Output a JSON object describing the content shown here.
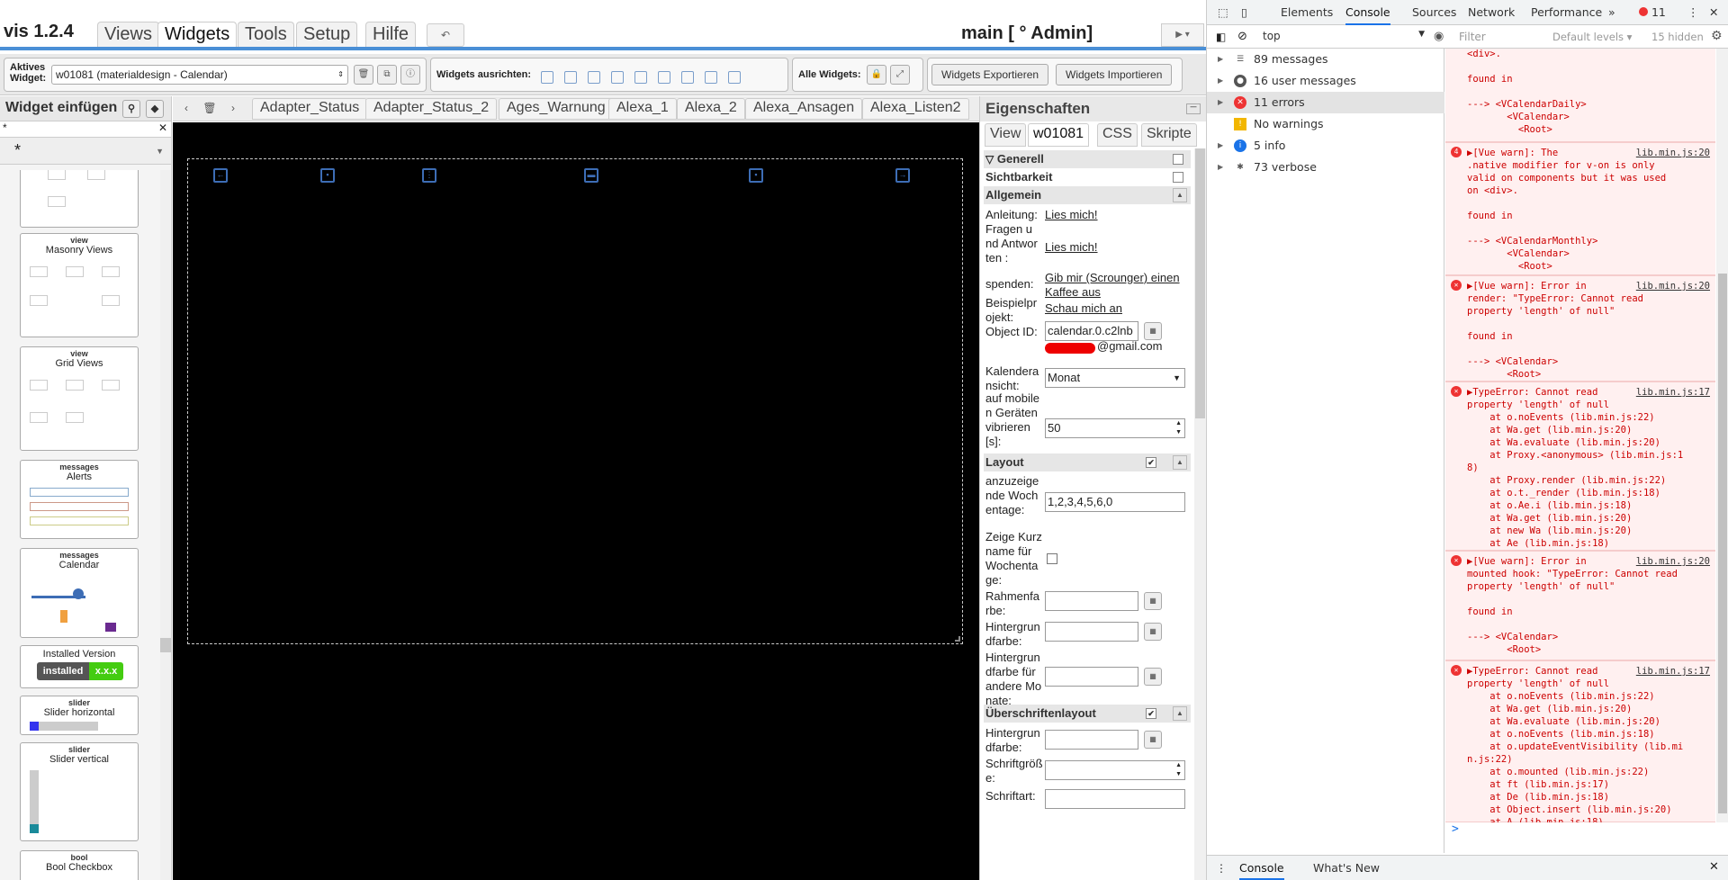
{
  "app": {
    "version": "vis 1.2.4",
    "menu_tabs": [
      "Views",
      "Widgets",
      "Tools",
      "Setup",
      "Hilfe"
    ],
    "project": "main [ ° Admin]"
  },
  "toolbar": {
    "active_label": "Aktives Widget:",
    "active_widget": "w01081 (materialdesign - Calendar)",
    "align_label": "Widgets ausrichten:",
    "all_label": "Alle Widgets:",
    "export_button": "Widgets Exportieren",
    "import_button": "Widgets Importieren"
  },
  "left_panel": {
    "title": "Widget einfügen",
    "filter_value": "*",
    "category": "*",
    "widgets": [
      {
        "type": "view",
        "name": "Masonry Views"
      },
      {
        "type": "view",
        "name": "Grid Views"
      },
      {
        "type": "messages",
        "name": "Alerts"
      },
      {
        "type": "messages",
        "name": "Calendar"
      },
      {
        "type": "",
        "name": "Installed Version"
      },
      {
        "type": "slider",
        "name": "Slider horizontal"
      },
      {
        "type": "slider",
        "name": "Slider vertical"
      },
      {
        "type": "bool",
        "name": "Bool Checkbox"
      }
    ],
    "installed_badge": "installed",
    "installed_version": "x.x.x"
  },
  "view_tabs": [
    "Adapter_Status",
    "Adapter_Status_2",
    "Ages_Warnung",
    "Alexa_1",
    "Alexa_2",
    "Alexa_Ansagen",
    "Alexa_Listen2"
  ],
  "properties": {
    "title": "Eigenschaften",
    "tabs": [
      "View",
      "w01081",
      "CSS",
      "Skripte"
    ],
    "sections": {
      "generell": "Generell",
      "sichtbarkeit": "Sichtbarkeit",
      "allgemein": "Allgemein",
      "layout": "Layout",
      "ueberschriften": "Überschriftenlayout"
    },
    "anleitung_label": "Anleitung:",
    "anleitung_link": "Lies mich!",
    "faq_label": "Fragen und Antworten :",
    "faq_link": "Lies mich!",
    "spenden_label": "spenden:",
    "spenden_link": "Gib mir (Scrounger) einen Kaffee aus",
    "beispiel_label": "Beispielprojekt:",
    "beispiel_link": "Schau mich an",
    "object_id_label": "Object ID:",
    "object_id_value": "calendar.0.c2lnb",
    "object_email": "@gmail.com",
    "ansicht_label": "Kalenderansicht:",
    "ansicht_value": "Monat",
    "vibrate_label": "auf mobilen Geräten vibrieren [s]:",
    "vibrate_value": "50",
    "wochentage_label": "anzuzeigende Wochentage:",
    "wochentage_value": "1,2,3,4,5,6,0",
    "kurzname_label": "Zeige Kurzname für Wochentage:",
    "rahmen_label": "Rahmenfarbe:",
    "hintergrund_label": "Hintergrundfarbe:",
    "hintergrund_andere_label": "Hintergrundfarbe für andere Monate:",
    "ueber_hintergrund_label": "Hintergrundfarbe:",
    "schriftgroesse_label": "Schriftgröße:",
    "schriftart_label": "Schriftart:"
  },
  "devtools": {
    "tabs": [
      "Elements",
      "Console",
      "Sources",
      "Network",
      "Performance"
    ],
    "error_count": "11",
    "context": "top",
    "filter_placeholder": "Filter",
    "levels": "Default levels",
    "hidden": "15 hidden",
    "sidebar": [
      {
        "text": "89 messages",
        "icon": "list-icon"
      },
      {
        "text": "16 user messages",
        "icon": "user-icon"
      },
      {
        "text": "11 errors",
        "icon": "error-icon"
      },
      {
        "text": "No warnings",
        "icon": "warning-icon"
      },
      {
        "text": "5 info",
        "icon": "info-icon"
      },
      {
        "text": "73 verbose",
        "icon": "bug-icon"
      }
    ],
    "log": [
      {
        "text": "<div>.\n\nfound in\n\n---> <VCalendarDaily>\n       <VCalendar>\n         <Root>",
        "src": ""
      },
      {
        "text": "▶[Vue warn]: The\n.native modifier for v-on is only\nvalid on components but it was used\non <div>.\n\nfound in\n\n---> <VCalendarMonthly>\n       <VCalendar>\n         <Root>",
        "src": "lib.min.js:20",
        "badge": "4"
      },
      {
        "text": "▶[Vue warn]: Error in\nrender: \"TypeError: Cannot read\nproperty 'length' of null\"\n\nfound in\n\n---> <VCalendar>\n       <Root>",
        "src": "lib.min.js:20"
      },
      {
        "text": "▶TypeError: Cannot read\nproperty 'length' of null\n    at o.noEvents (lib.min.js:22)\n    at Wa.get (lib.min.js:20)\n    at Wa.evaluate (lib.min.js:20)\n    at Proxy.<anonymous> (lib.min.js:1\n8)\n    at Proxy.render (lib.min.js:22)\n    at o.t._render (lib.min.js:18)\n    at o.Ae.i (lib.min.js:18)\n    at Wa.get (lib.min.js:20)\n    at new Wa (lib.min.js:20)\n    at Ae (lib.min.js:18)",
        "src": "lib.min.js:17"
      },
      {
        "text": "▶[Vue warn]: Error in\nmounted hook: \"TypeError: Cannot read\nproperty 'length' of null\"\n\nfound in\n\n---> <VCalendar>\n       <Root>",
        "src": "lib.min.js:20"
      },
      {
        "text": "▶TypeError: Cannot read\nproperty 'length' of null\n    at o.noEvents (lib.min.js:22)\n    at Wa.get (lib.min.js:20)\n    at Wa.evaluate (lib.min.js:20)\n    at o.noEvents (lib.min.js:18)\n    at o.updateEventVisibility (lib.mi\nn.js:22)\n    at o.mounted (lib.min.js:22)\n    at ft (lib.min.js:17)\n    at De (lib.min.js:18)\n    at Object.insert (lib.min.js:20)\n    at A (lib.min.js:18)",
        "src": "lib.min.js:17"
      }
    ],
    "prompt": ">",
    "bottom_tabs": [
      "Console",
      "What's New"
    ]
  }
}
